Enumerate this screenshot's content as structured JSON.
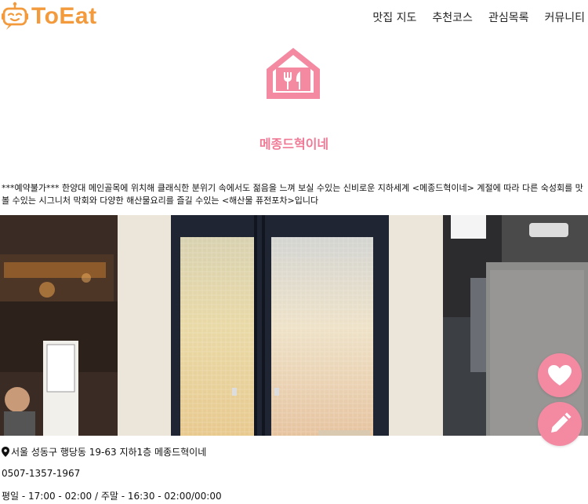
{
  "app": {
    "name": "ToEat",
    "brand_color": "#f39a3c",
    "accent_color": "#f07a96"
  },
  "nav": {
    "items": [
      "맛집 지도",
      "추천코스",
      "관심목록",
      "커뮤니티"
    ]
  },
  "place": {
    "name": "메종드혁이네",
    "description": "***예약불가*** 한양대 메인골목에 위치해 클래식한 분위기 속에서도 젊음을 느껴 보실 수있는 신비로운 지하세계 <메종드혁이네> 계절에 따라 다른 숙성회를 맛 볼 수있는 시그니처 막회와 다양한 해산물요리를 즐길 수있는 <해산물 퓨전포차>입니다",
    "address": "서울 성동구 행당동 19-63 지하1층 메종드혁이네",
    "phone": "0507-1357-1967",
    "hours": "평일 - 17:00 - 02:00 / 주말 - 16:30 - 02:00/00:00"
  },
  "icons": {
    "logo": "robot-logo-icon",
    "category": "restaurant-house-icon",
    "address": "map-pin-icon",
    "like": "heart-icon",
    "edit": "pencil-icon"
  }
}
